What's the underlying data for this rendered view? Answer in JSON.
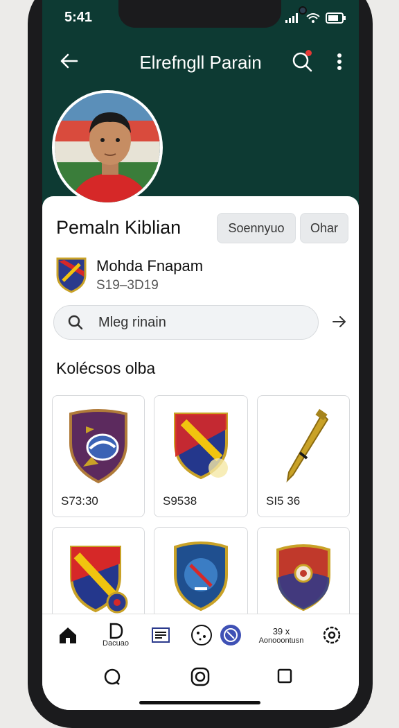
{
  "status": {
    "time": "5:41"
  },
  "header": {
    "title": "Elrefngll Parain"
  },
  "profile": {
    "name": "Pemaln Kiblian",
    "subscribe_label": "Soennyuo",
    "chat_label": "Ohar",
    "club_name": "Mohda Fnapam",
    "club_years": "S19–3D19"
  },
  "search": {
    "value": "Mleg rinain"
  },
  "collection": {
    "title": "Kolécsos olba",
    "items": [
      {
        "price": "S73:30",
        "icon": "purple-crest"
      },
      {
        "price": "S9538",
        "icon": "striped-crest"
      },
      {
        "price": "SI5 36",
        "icon": "golden-pen"
      },
      {
        "price": "",
        "icon": "eba-crest"
      },
      {
        "price": "",
        "icon": "blue-shield"
      },
      {
        "price": "",
        "icon": "red-shield"
      }
    ]
  },
  "nav": {
    "items": [
      {
        "label": "",
        "icon": "home-icon"
      },
      {
        "label": "Dacuao",
        "icon": "d-icon"
      },
      {
        "label": "",
        "icon": "news-icon"
      },
      {
        "label": "",
        "icon": "face-icon"
      },
      {
        "label": "",
        "icon": "circle-icon"
      },
      {
        "label": "Aonooontusn",
        "badge": "39 x",
        "icon": "text-icon"
      },
      {
        "label": "",
        "icon": "settings-icon"
      }
    ]
  },
  "colors": {
    "header_bg": "#0d3a33",
    "accent_blue": "#3f51b5",
    "card_bg": "#ffffff"
  }
}
